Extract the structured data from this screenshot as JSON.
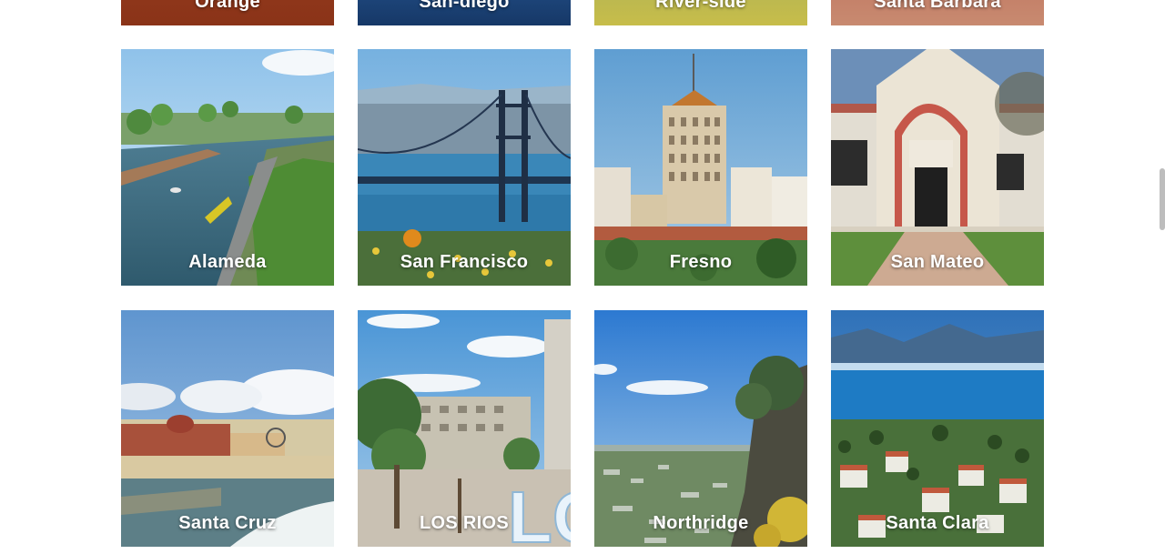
{
  "cities": [
    {
      "name": "Orange"
    },
    {
      "name": "San-diego"
    },
    {
      "name": "River-side"
    },
    {
      "name": "Santa Barbara"
    },
    {
      "name": "Alameda"
    },
    {
      "name": "San Francisco"
    },
    {
      "name": "Fresno"
    },
    {
      "name": "San Mateo"
    },
    {
      "name": "Santa Cruz"
    },
    {
      "name": "LOS RIOS"
    },
    {
      "name": "Northridge"
    },
    {
      "name": "Santa Clara"
    }
  ],
  "colors": {
    "label_text": "#ffffff",
    "page_background": "#ffffff",
    "scrollbar": "#bdbdbd"
  }
}
